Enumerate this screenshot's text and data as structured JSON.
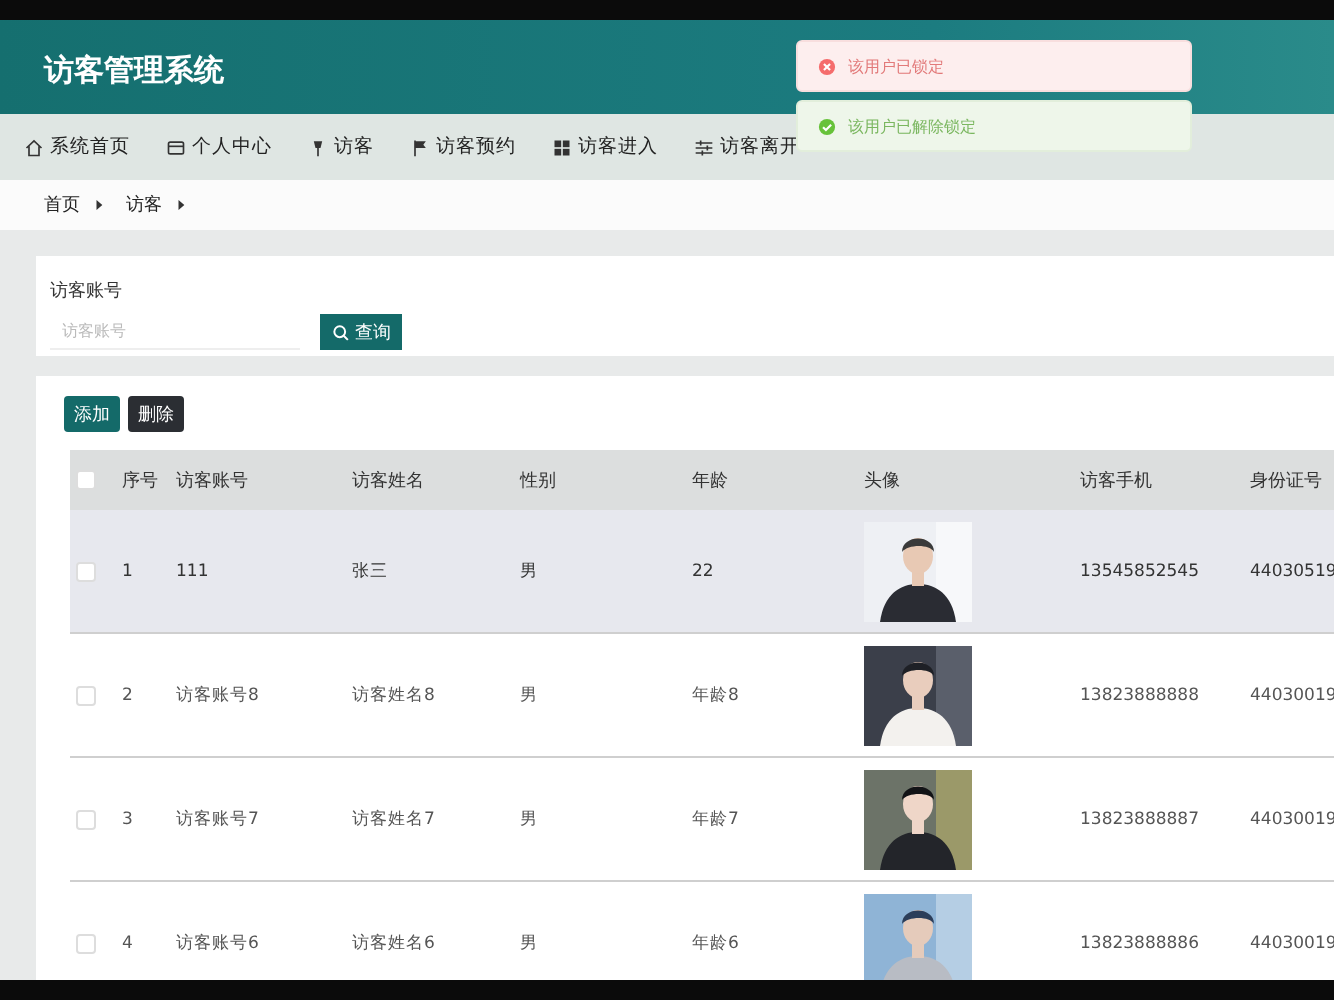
{
  "app": {
    "title": "访客管理系统"
  },
  "nav": [
    "系统首页",
    "个人中心",
    "访客",
    "访客预约",
    "访客进入",
    "访客离开"
  ],
  "toasts": [
    {
      "kind": "error",
      "text": "该用户已锁定"
    },
    {
      "kind": "success",
      "text": "该用户已解除锁定"
    }
  ],
  "breadcrumb": [
    "首页",
    "访客"
  ],
  "search": {
    "label": "访客账号",
    "placeholder": "访客账号",
    "button": "查询"
  },
  "actions": [
    {
      "label": "添加",
      "kind": "primary"
    },
    {
      "label": "删除",
      "kind": "dark"
    }
  ],
  "table": {
    "header_checked": false,
    "columns": [
      "序号",
      "访客账号",
      "访客姓名",
      "性别",
      "年龄",
      "头像",
      "访客手机",
      "身份证号"
    ],
    "rows": [
      {
        "selected": true,
        "checked": false,
        "cells": [
          "1",
          "111",
          "张三",
          "男",
          "22"
        ],
        "avatar": {
          "kind": "picture"
        },
        "phone": "13545852545",
        "id_number": "44030519"
      },
      {
        "selected": false,
        "checked": false,
        "cells": [
          "2",
          "访客账号8",
          "访客姓名8",
          "男",
          "年龄8"
        ],
        "avatar": {
          "kind": "picture"
        },
        "phone": "13823888888",
        "id_number": "44030019"
      },
      {
        "selected": false,
        "checked": false,
        "cells": [
          "3",
          "访客账号7",
          "访客姓名7",
          "男",
          "年龄7"
        ],
        "avatar": {
          "kind": "picture"
        },
        "phone": "13823888887",
        "id_number": "44030019"
      },
      {
        "selected": false,
        "checked": false,
        "cells": [
          "4",
          "访客账号6",
          "访客姓名6",
          "男",
          "年龄6"
        ],
        "avatar": {
          "kind": "picture"
        },
        "phone": "13823888886",
        "id_number": "44030019"
      }
    ]
  }
}
